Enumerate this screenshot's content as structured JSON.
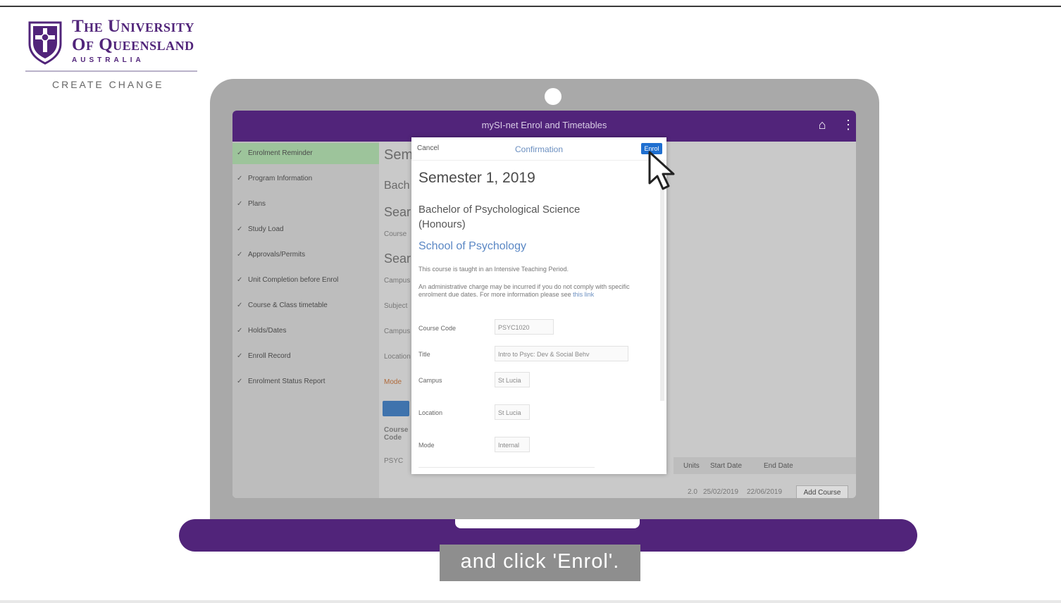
{
  "logo": {
    "line1": "The University",
    "line2": "Of Queensland",
    "country": "AUSTRALIA",
    "tagline": "CREATE CHANGE",
    "brand_color": "#51247a"
  },
  "caption": "and click 'Enrol'.",
  "app": {
    "title": "mySI-net Enrol and Timetables",
    "sidebar_items": [
      {
        "label": "Enrolment Reminder",
        "active": true
      },
      {
        "label": "Program Information",
        "active": false
      },
      {
        "label": "Plans",
        "active": false
      },
      {
        "label": "Study Load",
        "active": false
      },
      {
        "label": "Approvals/Permits",
        "active": false
      },
      {
        "label": "Unit Completion before Enrol",
        "active": false
      },
      {
        "label": "Course & Class timetable",
        "active": false
      },
      {
        "label": "Holds/Dates",
        "active": false
      },
      {
        "label": "Enroll Record",
        "active": false
      },
      {
        "label": "Enrolment Status Report",
        "active": false
      }
    ],
    "background_text": {
      "heading1": "Sem",
      "heading2": "Bach",
      "heading3": "Sear",
      "heading4": "Sear",
      "small_labels": [
        "Course",
        "Campus",
        "Subject",
        "Campus",
        "Location",
        "Mode"
      ],
      "table_headers": [
        "Units",
        "Start Date",
        "End Date"
      ],
      "table_left_header": "Course Code",
      "table_row": {
        "code": "PSYC",
        "units": "2.0",
        "start": "25/02/2019",
        "end": "22/06/2019"
      },
      "add_course_label": "Add Course"
    }
  },
  "modal": {
    "cancel_label": "Cancel",
    "heading": "Confirmation",
    "enrol_label": "Enrol",
    "semester": "Semester 1, 2019",
    "program": "Bachelor of Psychological Science (Honours)",
    "school": "School of Psychology",
    "note1": "This course is taught in an Intensive Teaching Period.",
    "note2": "An administrative charge may be incurred if you do not comply with specific enrolment due dates. For more information please see",
    "note2_link": "this link",
    "fields": [
      {
        "label": "Course Code",
        "value": "PSYC1020"
      },
      {
        "label": "Title",
        "value": "Intro to Psyc: Dev & Social Behv"
      },
      {
        "label": "Campus",
        "value": "St Lucia"
      },
      {
        "label": "Location",
        "value": "St Lucia"
      },
      {
        "label": "Mode",
        "value": "Internal"
      }
    ]
  },
  "icons": {
    "home": "home-icon",
    "more": "more-vertical-icon",
    "cursor": "pointer-cursor-icon",
    "crest": "uq-crest-icon"
  }
}
